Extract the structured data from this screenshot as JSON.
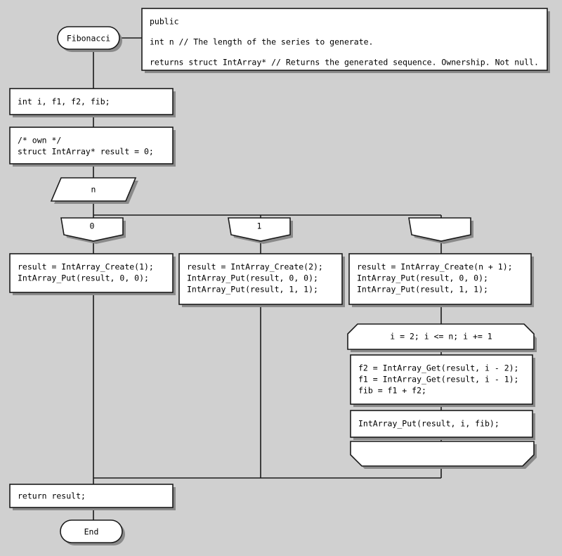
{
  "diagram": {
    "title": "Fibonacci flowchart",
    "background_color": "#d0d0d0",
    "shape_fill": "#ffffff",
    "line_color": "#1a1a1a",
    "shadow_color": "#8a8a8a"
  },
  "start": {
    "label": "Fibonacci"
  },
  "annotation": {
    "line1": "public",
    "line2": "int n // The length of the series to generate.",
    "line3": "returns struct IntArray* // Returns the generated sequence. Ownership. Not null."
  },
  "declare_vars": {
    "line1": "int i, f1, f2, fib;"
  },
  "declare_result": {
    "line1": "/* own */",
    "line2": "struct IntArray* result = 0;"
  },
  "switch": {
    "selector": "n",
    "cases": [
      {
        "label": "0"
      },
      {
        "label": "1"
      },
      {
        "label": ""
      }
    ]
  },
  "case_zero_body": {
    "line1": "result = IntArray_Create(1);",
    "line2": "IntArray_Put(result, 0, 0);"
  },
  "case_one_body": {
    "line1": "result = IntArray_Create(2);",
    "line2": "IntArray_Put(result, 0, 0);",
    "line3": "IntArray_Put(result, 1, 1);"
  },
  "case_default_body": {
    "line1": "result = IntArray_Create(n + 1);",
    "line2": "IntArray_Put(result, 0, 0);",
    "line3": "IntArray_Put(result, 1, 1);"
  },
  "loop": {
    "header": "i = 2; i <= n; i += 1",
    "body": {
      "line1": "f2 = IntArray_Get(result, i - 2);",
      "line2": "f1 = IntArray_Get(result, i - 1);",
      "line3": "fib = f1 + f2;"
    },
    "body2": {
      "line1": "IntArray_Put(result, i, fib);"
    },
    "footer": ""
  },
  "return_stmt": {
    "line1": "return result;"
  },
  "end": {
    "label": "End"
  }
}
